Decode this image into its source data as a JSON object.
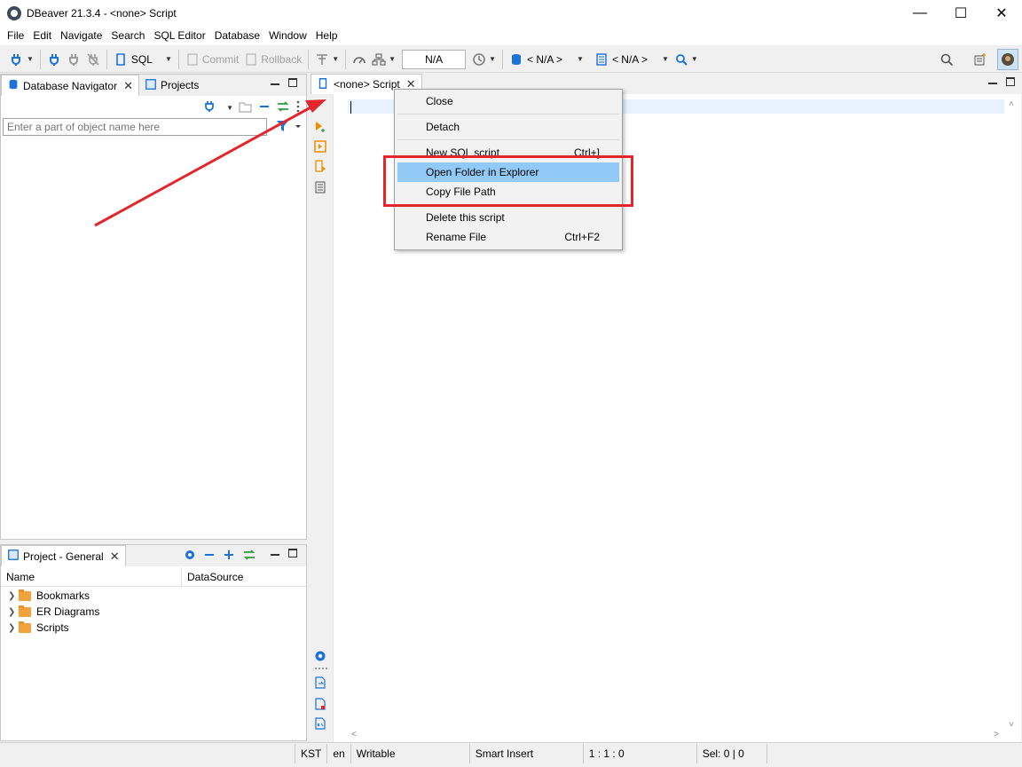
{
  "window": {
    "title": "DBeaver 21.3.4 - <none> Script"
  },
  "menu": [
    "File",
    "Edit",
    "Navigate",
    "Search",
    "SQL Editor",
    "Database",
    "Window",
    "Help"
  ],
  "toolbar": {
    "sql_label": "SQL",
    "commit_label": "Commit",
    "rollback_label": "Rollback",
    "transaction_mode": "N/A",
    "datasource": "< N/A >",
    "schema": "< N/A >"
  },
  "navigator": {
    "tabs": [
      "Database Navigator",
      "Projects"
    ],
    "filter_placeholder": "Enter a part of object name here"
  },
  "project_panel": {
    "tab": "Project - General",
    "columns": [
      "Name",
      "DataSource"
    ],
    "items": [
      "Bookmarks",
      "ER Diagrams",
      "Scripts"
    ]
  },
  "editor": {
    "tab_label": "<none> Script"
  },
  "context_menu": {
    "items": [
      {
        "label": "Close",
        "shortcut": ""
      },
      {
        "label": "Detach",
        "shortcut": ""
      },
      {
        "label": "New SQL script",
        "shortcut": "Ctrl+]"
      },
      {
        "label": "Open Folder in Explorer",
        "shortcut": "",
        "highlighted": true
      },
      {
        "label": "Copy File Path",
        "shortcut": ""
      },
      {
        "label": "Delete this script",
        "shortcut": ""
      },
      {
        "label": "Rename File",
        "shortcut": "Ctrl+F2"
      }
    ]
  },
  "status": {
    "timezone": "KST",
    "locale": "en",
    "mode": "Writable",
    "insert_mode": "Smart Insert",
    "position": "1 : 1 : 0",
    "selection": "Sel: 0 | 0"
  },
  "colors": {
    "accent": "#1a73d9",
    "menu_highlight": "#91c9f7",
    "annotation_red": "#e3262c",
    "folder_orange": "#f2a23a"
  }
}
